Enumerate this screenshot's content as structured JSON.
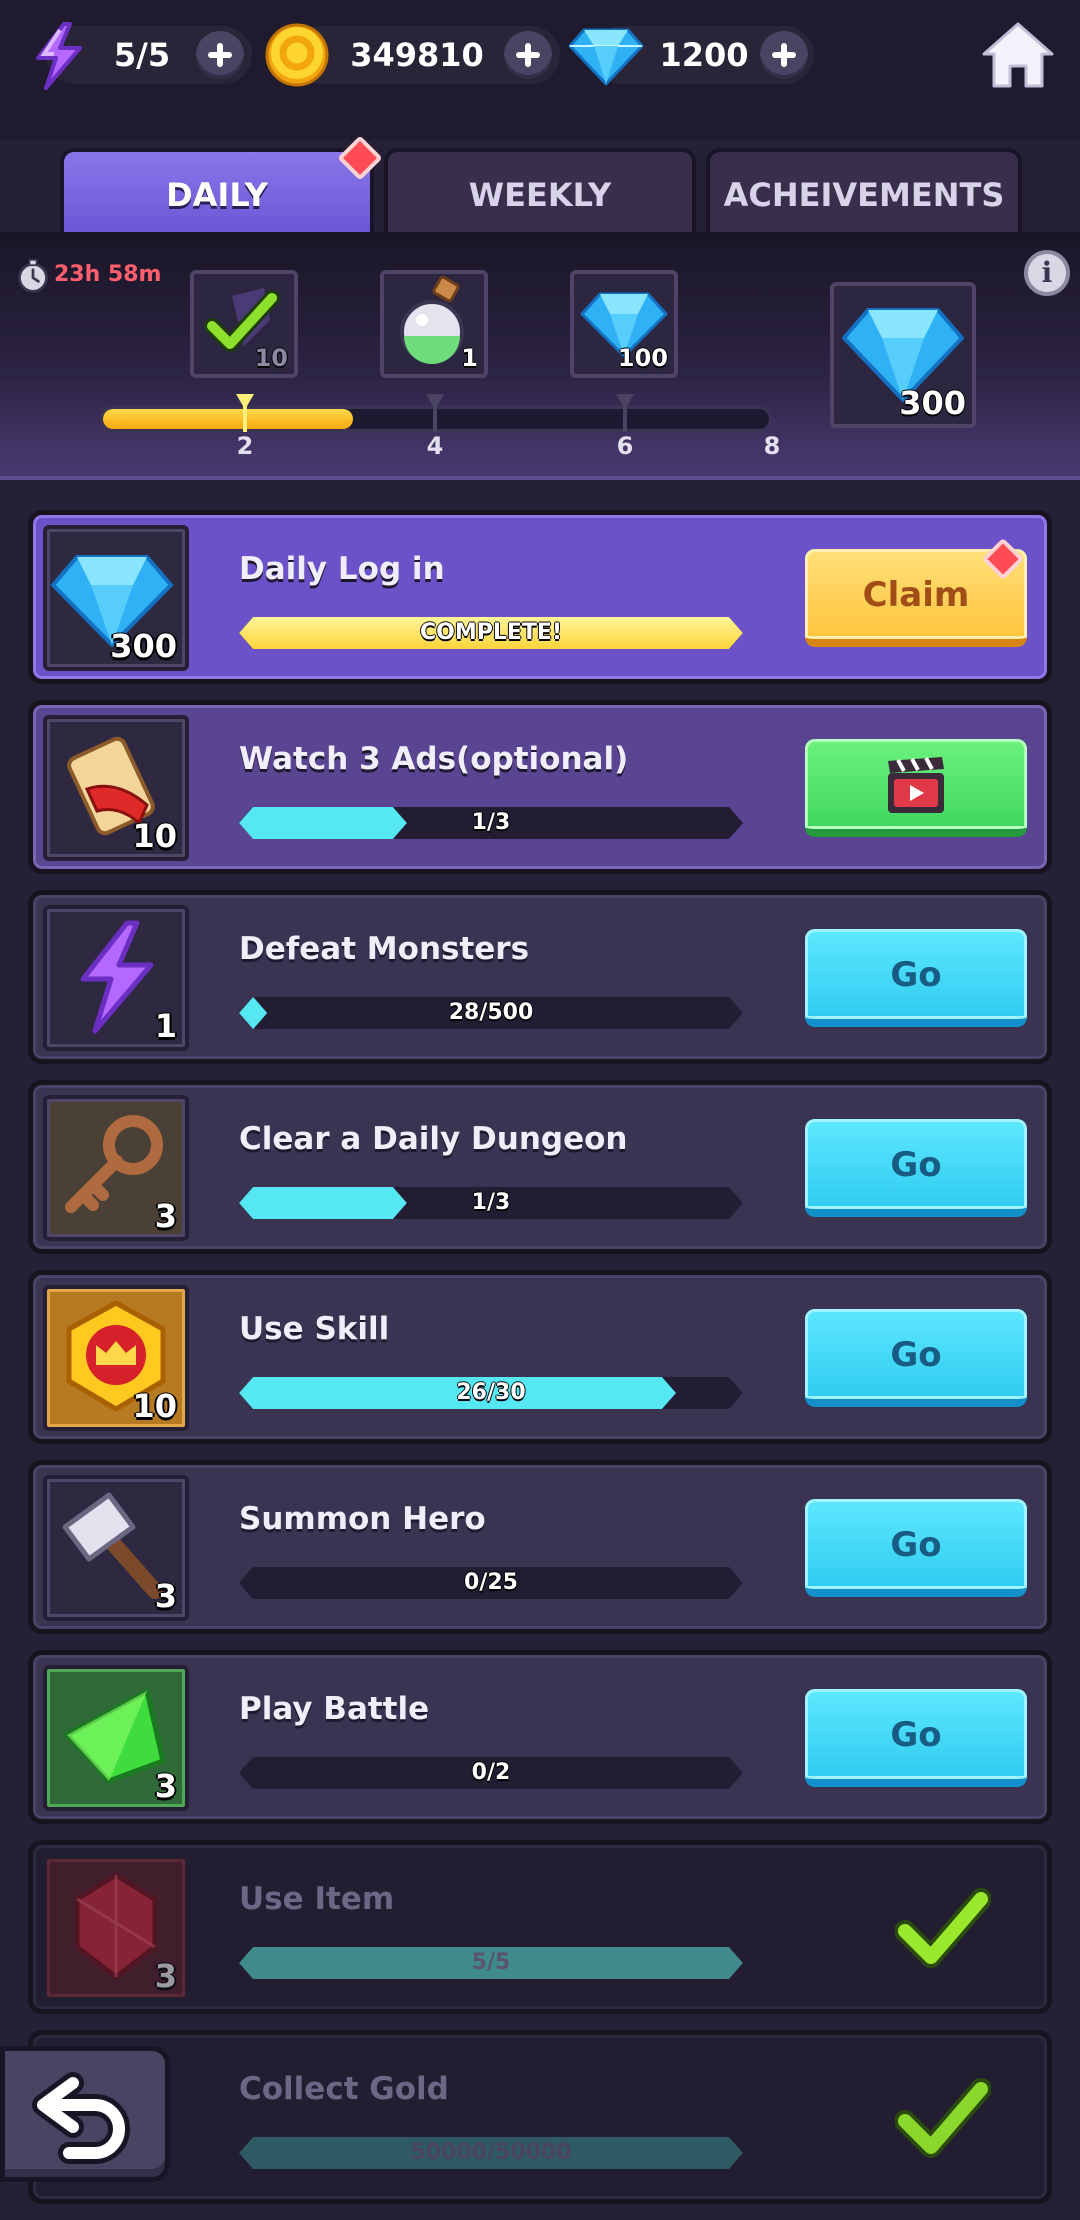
{
  "top_bar": {
    "energy": {
      "icon": "lightning-icon",
      "value": "5/5"
    },
    "gold": {
      "icon": "gold-coin-icon",
      "value": "349810"
    },
    "gems": {
      "icon": "gem-icon",
      "value": "1200"
    },
    "home_icon": "home-icon"
  },
  "tabs": [
    {
      "label": "DAILY",
      "active": true
    },
    {
      "label": "WEEKLY",
      "active": false
    },
    {
      "label": "ACHEIVEMENTS",
      "active": false
    }
  ],
  "milestones": {
    "timer": "23h 58m",
    "progress_points": 3,
    "max_points": 8,
    "markers": [
      "2",
      "4",
      "6",
      "8"
    ],
    "rewards": [
      {
        "icon": "checkmark-icon",
        "count": "10"
      },
      {
        "icon": "potion-icon",
        "count": "1"
      },
      {
        "icon": "gem-icon",
        "count": "100"
      },
      {
        "icon": "gem-icon",
        "count": "300"
      }
    ]
  },
  "quests": [
    {
      "title": "Daily Log in",
      "reward_icon": "gem-icon",
      "reward_count": "300",
      "progress_text": "COMPLETE!",
      "progress": 1.0,
      "action": "Claim"
    },
    {
      "title": "Watch 3 Ads(optional)",
      "reward_icon": "scroll-icon",
      "reward_count": "10",
      "progress_text": "1/3",
      "progress": 0.333,
      "action": "video-icon"
    },
    {
      "title": "Defeat Monsters",
      "reward_icon": "lightning-icon",
      "reward_count": "1",
      "progress_text": "28/500",
      "progress": 0.056,
      "action": "Go"
    },
    {
      "title": "Clear a Daily Dungeon",
      "reward_icon": "key-icon",
      "reward_count": "3",
      "progress_text": "1/3",
      "progress": 0.333,
      "action": "Go"
    },
    {
      "title": "Use Skill",
      "reward_icon": "crown-medal-icon",
      "reward_count": "10",
      "progress_text": "26/30",
      "progress": 0.867,
      "action": "Go"
    },
    {
      "title": "Summon Hero",
      "reward_icon": "hammer-icon",
      "reward_count": "3",
      "progress_text": "0/25",
      "progress": 0.0,
      "action": "Go"
    },
    {
      "title": "Play Battle",
      "reward_icon": "green-crystal-icon",
      "reward_count": "3",
      "progress_text": "0/2",
      "progress": 0.0,
      "action": "Go"
    },
    {
      "title": "Use Item",
      "reward_icon": "red-gem-icon",
      "reward_count": "3",
      "progress_text": "5/5",
      "progress": 1.0,
      "action": "checkmark-icon"
    },
    {
      "title": "Collect Gold",
      "reward_icon": "gold-icon",
      "reward_count": "",
      "progress_text": "50000/50000",
      "progress": 1.0,
      "action": "checkmark-icon"
    }
  ],
  "back_icon": "back-arrow-icon"
}
